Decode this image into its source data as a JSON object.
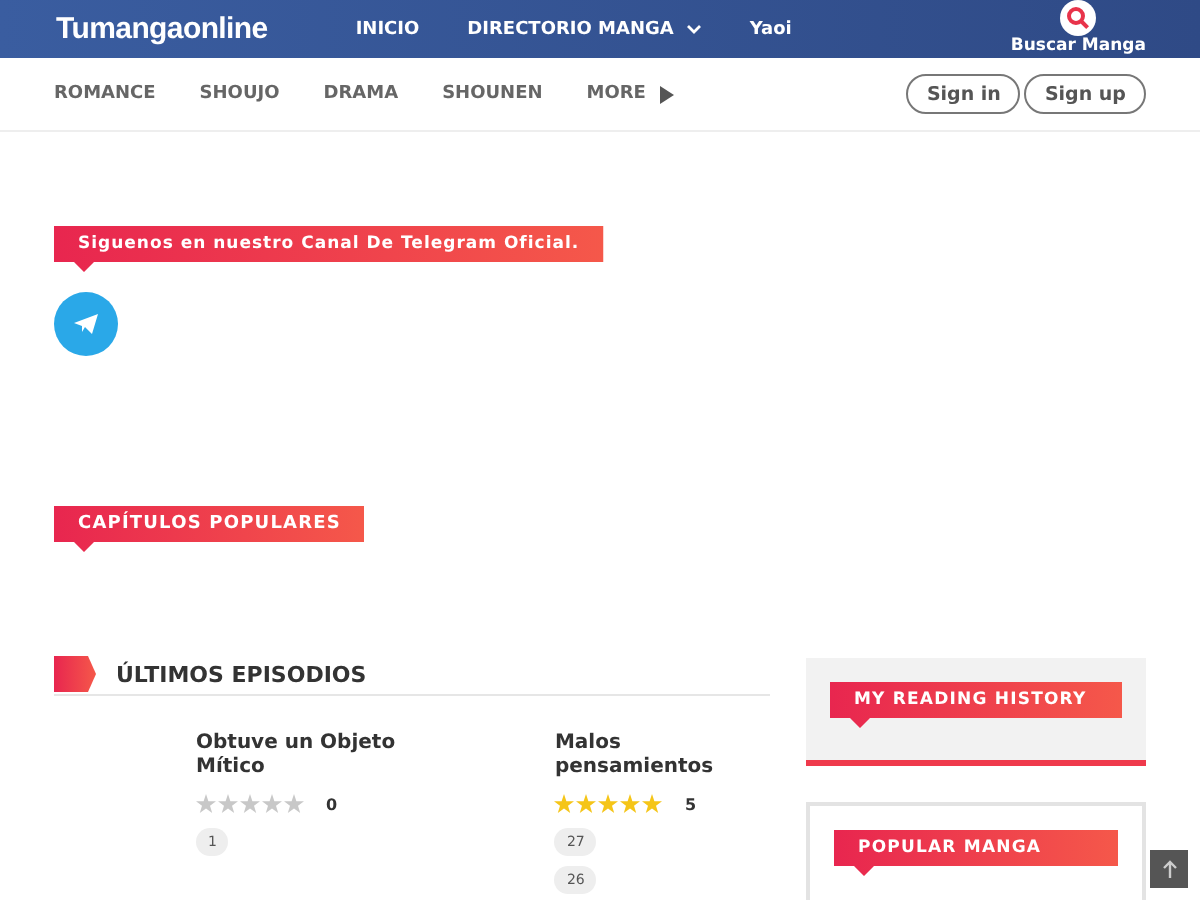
{
  "header": {
    "logo": "Tumangaonline",
    "nav": [
      {
        "label": "INICIO",
        "dropdown": false
      },
      {
        "label": "DIRECTORIO MANGA",
        "dropdown": true
      },
      {
        "label": "Yaoi",
        "dropdown": false
      }
    ],
    "search_label": "Buscar Manga"
  },
  "genres": [
    {
      "label": "ROMANCE",
      "kind": "link"
    },
    {
      "label": "SHOUJO",
      "kind": "link"
    },
    {
      "label": "DRAMA",
      "kind": "link"
    },
    {
      "label": "SHOUNEN",
      "kind": "link"
    },
    {
      "label": "MORE",
      "kind": "more"
    }
  ],
  "auth_buttons": [
    "Sign in",
    "Sign up"
  ],
  "telegram_banner": "Siguenos en nuestro Canal De Telegram Oficial.",
  "popular_chapters_title": "CAPÍTULOS POPULARES",
  "latest": {
    "title": "ÚLTIMOS EPISODIOS",
    "items": [
      {
        "title": "Obtuve un Objeto Mítico",
        "stars": 0,
        "rating": "0",
        "chapters": [
          "1"
        ]
      },
      {
        "title": "Malos pensamientos",
        "stars": 5,
        "rating": "5",
        "chapters": [
          "27",
          "26"
        ]
      }
    ]
  },
  "sidebar": {
    "history_title": "MY READING HISTORY",
    "popular_title": "POPULAR MANGA"
  }
}
